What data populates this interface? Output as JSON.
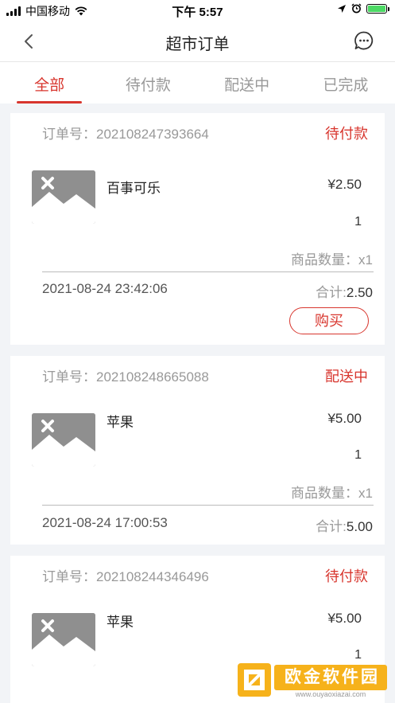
{
  "status_bar": {
    "carrier": "中国移动",
    "time": "下午 5:57"
  },
  "nav": {
    "title": "超市订单",
    "back_icon": "chevron-left-icon",
    "message_icon": "chat-bubble-icon"
  },
  "tabs": [
    {
      "label": "全部",
      "active": true
    },
    {
      "label": "待付款",
      "active": false
    },
    {
      "label": "配送中",
      "active": false
    },
    {
      "label": "已完成",
      "active": false
    }
  ],
  "orders": [
    {
      "order_label": "订单号：",
      "order_no": "202108247393664",
      "status": "待付款",
      "product_name": "百事可乐",
      "price": "¥2.50",
      "qty": "1",
      "count_label": "商品数量：",
      "count_value": "x1",
      "time": "2021-08-24 23:42:06",
      "total_label": "合计:",
      "total_value": "2.50",
      "action": "购买"
    },
    {
      "order_label": "订单号：",
      "order_no": "202108248665088",
      "status": "配送中",
      "product_name": "苹果",
      "price": "¥5.00",
      "qty": "1",
      "count_label": "商品数量：",
      "count_value": "x1",
      "time": "2021-08-24 17:00:53",
      "total_label": "合计:",
      "total_value": "5.00"
    },
    {
      "order_label": "订单号：",
      "order_no": "202108244346496",
      "status": "待付款",
      "product_name": "苹果",
      "price": "¥5.00",
      "qty": "1"
    }
  ],
  "watermark": {
    "name": "欧金软件园",
    "url": "www.ouyaoxiazai.com"
  },
  "colors": {
    "accent": "#d8362e",
    "muted": "#999999",
    "background": "#f2f4f7",
    "battery": "#4cd964"
  }
}
